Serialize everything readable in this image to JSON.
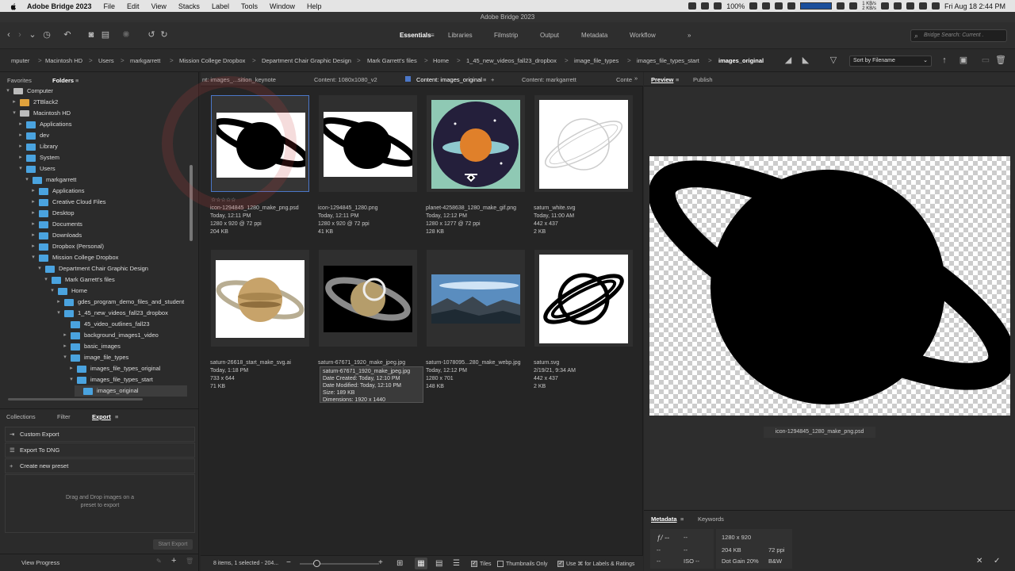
{
  "menubar": {
    "app_name": "Adobe Bridge 2023",
    "items": [
      "File",
      "Edit",
      "View",
      "Stacks",
      "Label",
      "Tools",
      "Window",
      "Help"
    ],
    "battery": "100%",
    "net_up": "1 KB/s",
    "net_down": "2 KB/s",
    "datetime": "Fri Aug 18  2:44 PM"
  },
  "window": {
    "title": "Adobe Bridge 2023"
  },
  "workspaces": {
    "tabs": [
      "Essentials",
      "Libraries",
      "Filmstrip",
      "Output",
      "Metadata",
      "Workflow"
    ],
    "active": "Essentials",
    "more": "»"
  },
  "search": {
    "placeholder": "Bridge Search: Current ."
  },
  "breadcrumb": {
    "items": [
      "mputer",
      "Macintosh HD",
      "Users",
      "markgarrett",
      "Mission College Dropbox",
      "Department Chair Graphic Design",
      "Mark Garrett's files",
      "Home",
      "1_45_new_videos_fall23_dropbox",
      "image_file_types",
      "images_file_types_start",
      "images_original"
    ],
    "separator": ">"
  },
  "sort": {
    "label": "Sort by Filename"
  },
  "left_panel": {
    "tabs": [
      "Favorites",
      "Folders"
    ],
    "active": "Folders",
    "tree": [
      {
        "label": "Computer",
        "type": "drive",
        "open": true
      },
      {
        "label": "2TBlack2",
        "type": "orange",
        "open": false
      },
      {
        "label": "Macintosh HD",
        "type": "drive",
        "open": true
      },
      {
        "label": "Applications",
        "type": "folder",
        "open": false
      },
      {
        "label": "dev",
        "type": "folder",
        "open": false
      },
      {
        "label": "Library",
        "type": "folder",
        "open": false
      },
      {
        "label": "System",
        "type": "folder",
        "open": false
      },
      {
        "label": "Users",
        "type": "folder",
        "open": true
      },
      {
        "label": "markgarrett",
        "type": "folder",
        "open": true
      },
      {
        "label": "Applications",
        "type": "folder",
        "open": false
      },
      {
        "label": "Creative Cloud Files",
        "type": "folder",
        "open": false
      },
      {
        "label": "Desktop",
        "type": "folder",
        "open": false
      },
      {
        "label": "Documents",
        "type": "folder",
        "open": false
      },
      {
        "label": "Downloads",
        "type": "folder",
        "open": false
      },
      {
        "label": "Dropbox (Personal)",
        "type": "folder",
        "open": false
      },
      {
        "label": "Mission College Dropbox",
        "type": "folder",
        "open": true
      },
      {
        "label": "Department Chair Graphic Design",
        "type": "folder",
        "open": true
      },
      {
        "label": "Mark Garrett's files",
        "type": "folder",
        "open": true
      },
      {
        "label": "Home",
        "type": "folder",
        "open": true
      },
      {
        "label": "gdes_program_demo_files_and_student",
        "type": "folder",
        "open": false
      },
      {
        "label": "1_45_new_videos_fall23_dropbox",
        "type": "folder",
        "open": true
      },
      {
        "label": "45_video_outlines_fall23",
        "type": "folder",
        "open": null
      },
      {
        "label": "background_images1_video",
        "type": "folder",
        "open": false
      },
      {
        "label": "basic_images",
        "type": "folder",
        "open": false
      },
      {
        "label": "image_file_types",
        "type": "folder",
        "open": true
      },
      {
        "label": "images_file_types_original",
        "type": "folder",
        "open": false
      },
      {
        "label": "images_file_types_start",
        "type": "folder",
        "open": true
      },
      {
        "label": "images_original",
        "type": "folder",
        "open": null
      }
    ]
  },
  "export_panel": {
    "tabs": [
      "Collections",
      "Filter",
      "Export"
    ],
    "active": "Export",
    "rows": [
      "Custom Export",
      "Export To DNG",
      "Create new preset"
    ],
    "drop_hint": "Drag and Drop images on a preset to export",
    "start_export": "Start Export",
    "view_progress": "View Progress"
  },
  "content_tabs": {
    "tabs": [
      "nt: images_...sition_keynote",
      "Content: 1080x1080_v2",
      "Content: images_original",
      "Content: markgarrett",
      "Conte"
    ],
    "active_index": 2,
    "more": "»"
  },
  "files": [
    {
      "name": "icon-1294845_1280_make_png.psd",
      "date": "Today, 12:11 PM",
      "dims": "1280 x 920 @ 72 ppi",
      "size": "204 KB",
      "selected": true,
      "rating": "☆☆☆☆☆",
      "thumb": "saturn-black"
    },
    {
      "name": "icon-1294845_1280.png",
      "date": "Today, 12:11 PM",
      "dims": "1280 x 920 @ 72 ppi",
      "size": "41 KB",
      "selected": false,
      "thumb": "saturn-black"
    },
    {
      "name": "planet-4258638_1280_make_gif.png",
      "date": "Today, 12:12 PM",
      "dims": "1280 x 1277 @ 72 ppi",
      "size": "128 KB",
      "selected": false,
      "thumb": "planet-flat"
    },
    {
      "name": "saturn_white.svg",
      "date": "Today, 11:00 AM",
      "dims": "442 x 437",
      "size": "2 KB",
      "selected": false,
      "thumb": "saturn-outline-light"
    },
    {
      "name": "saturn-26618_start_make_svg.ai",
      "date": "Today, 1:18 PM",
      "dims": "733 x 644",
      "size": "71 KB",
      "selected": false,
      "thumb": "saturn-real"
    },
    {
      "name": "saturn-67671_1920_make_jpeg.jpg",
      "date": "",
      "dims": "",
      "size": "",
      "selected": false,
      "thumb": "saturn-photo"
    },
    {
      "name": "saturn-1078095...280_make_webp.jpg",
      "date": "Today, 12:12 PM",
      "dims": "1280 x 701",
      "size": "148 KB",
      "selected": false,
      "thumb": "landscape"
    },
    {
      "name": "saturn.svg",
      "date": "2/19/21, 9:34 AM",
      "dims": "442 x 437",
      "size": "2 KB",
      "selected": false,
      "thumb": "saturn-outline"
    }
  ],
  "tooltip": {
    "lines": [
      "saturn-67671_1920_make_jpeg.jpg",
      "Date Created: Today, 12:10 PM",
      "Date Modified: Today, 12:10 PM",
      "Size: 189 KB",
      "Dimensions: 1920 x 1440"
    ]
  },
  "status": {
    "summary": "8 items, 1 selected - 204...",
    "tiles": "Tiles",
    "thumbs_only": "Thumbnails Only",
    "use_cmd": "Use ⌘ for Labels & Ratings"
  },
  "preview": {
    "tabs": [
      "Preview",
      "Publish"
    ],
    "active": "Preview",
    "caption": "icon-1294845_1280_make_png.psd"
  },
  "metadata": {
    "tabs": [
      "Metadata",
      "Keywords"
    ],
    "active": "Metadata",
    "fstop": "ƒ/ --",
    "shutter": "--",
    "a": "--",
    "b": "--",
    "c": "--",
    "iso": "ISO --",
    "dims": "1280 x 920",
    "size": "204 KB",
    "ppi": "72 ppi",
    "dotgain": "Dot Gain 20%",
    "mode": "B&W"
  },
  "colors": {
    "accent": "#4b77c8",
    "folder": "#4aa3df"
  }
}
